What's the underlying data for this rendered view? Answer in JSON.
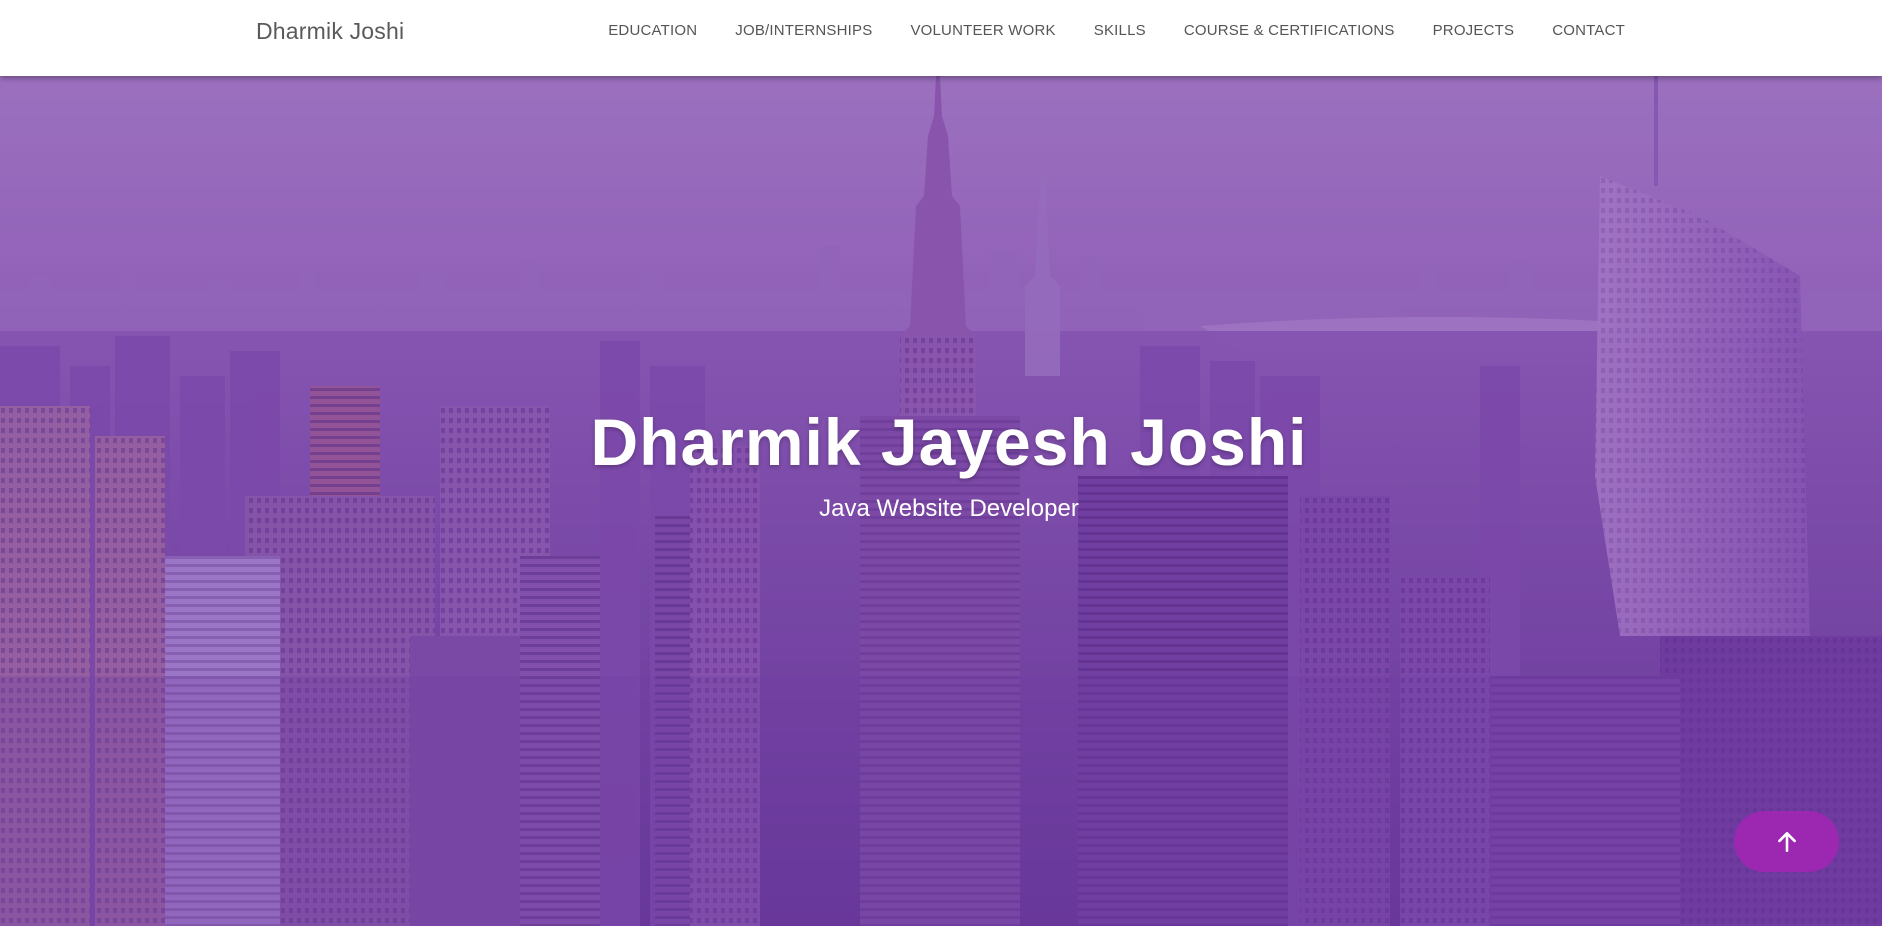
{
  "navbar": {
    "brand": "Dharmik Joshi",
    "links": [
      {
        "label": "EDUCATION"
      },
      {
        "label": "JOB/INTERNSHIPS"
      },
      {
        "label": "VOLUNTEER WORK"
      },
      {
        "label": "SKILLS"
      },
      {
        "label": "COURSE & CERTIFICATIONS"
      },
      {
        "label": "PROJECTS"
      },
      {
        "label": "CONTACT"
      }
    ]
  },
  "hero": {
    "title": "Dharmik Jayesh Joshi",
    "subtitle": "Java Website Developer",
    "background": "city-skyline-image"
  },
  "scroll_top": {
    "icon": "arrow-up-icon"
  },
  "colors": {
    "accent": "#9c27b0",
    "overlay": "#7a4aa6",
    "nav_text": "#555555"
  }
}
